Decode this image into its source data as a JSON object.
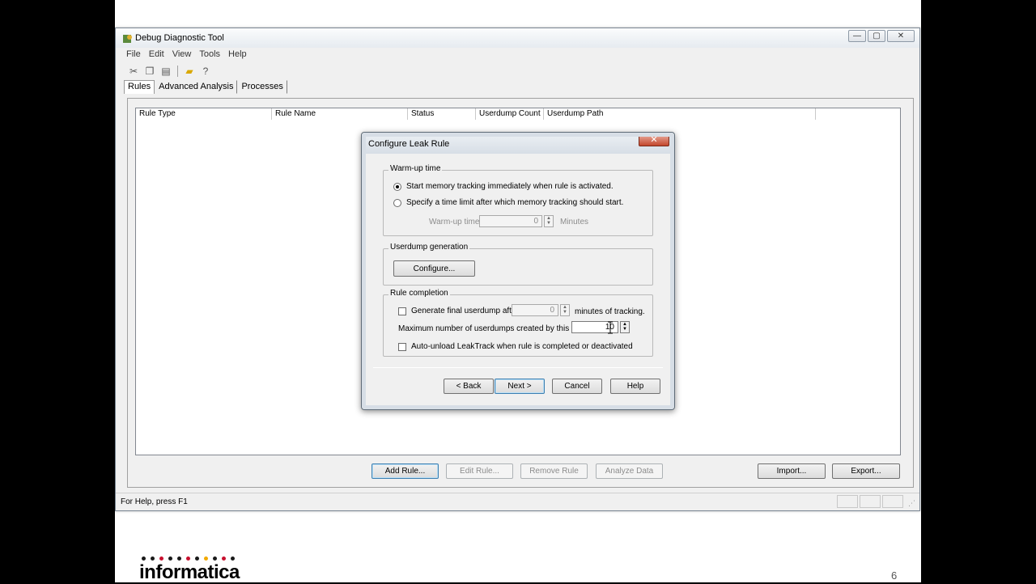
{
  "window": {
    "title": "Debug Diagnostic Tool",
    "caption_minimize": "—",
    "caption_maximize": "▢",
    "caption_close": "✕"
  },
  "menu": [
    "File",
    "Edit",
    "View",
    "Tools",
    "Help"
  ],
  "tabs": [
    "Rules",
    "Advanced Analysis",
    "Processes"
  ],
  "list": {
    "columns": [
      "Rule Type",
      "Rule Name",
      "Status",
      "Userdump Count",
      "Userdump Path",
      ""
    ]
  },
  "bottom_buttons": {
    "add_rule": "Add Rule...",
    "edit_rule": "Edit Rule...",
    "remove_rule": "Remove Rule",
    "analyze_data": "Analyze Data",
    "import": "Import...",
    "export": "Export..."
  },
  "status": {
    "text": "For Help, press F1"
  },
  "dialog": {
    "title": "Configure Leak Rule",
    "close": "✕",
    "warmup": {
      "label": "Warm-up time",
      "option_immediate": "Start memory tracking immediately when rule is activated.",
      "option_limit": "Specify a time limit after which memory tracking should start.",
      "field_label": "Warm-up time:",
      "field_value": "0",
      "unit": "Minutes"
    },
    "userdump": {
      "label": "Userdump generation",
      "configure": "Configure..."
    },
    "completion": {
      "label": "Rule completion",
      "final_dump_label": "Generate final userdump after",
      "final_dump_value": "0",
      "final_dump_unit": "minutes of tracking.",
      "max_label": "Maximum number of userdumps created by this rule:",
      "max_value": "10",
      "auto_unload": "Auto-unload LeakTrack when rule is completed or deactivated"
    },
    "buttons": {
      "back": "< Back",
      "next": "Next >",
      "cancel": "Cancel",
      "help": "Help"
    }
  },
  "footer": {
    "logo": "informatica",
    "page_number": "6",
    "dot_colors": [
      "#1a1a1a",
      "#1a1a1a",
      "#c8102e",
      "#1a1a1a",
      "#1a1a1a",
      "#c8102e",
      "#1a1a1a",
      "#f2a900",
      "#1a1a1a",
      "#c8102e",
      "#1a1a1a"
    ]
  }
}
